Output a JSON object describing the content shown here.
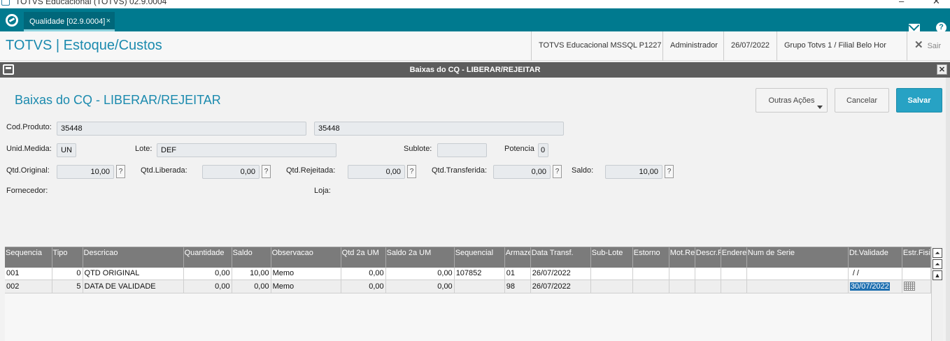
{
  "window": {
    "title": "TOTVS Educacional (TOTVS) 02.9.0004",
    "min": "–",
    "close": "✕"
  },
  "tabbar": {
    "tab_label": "Qualidade [02.9.0004]",
    "tab_close": "×"
  },
  "header": {
    "app_title": "TOTVS | Estoque/Custos",
    "environment": "TOTVS Educacional MSSQL P1227",
    "user": "Administrador",
    "date": "26/07/2022",
    "branch": "Grupo Totvs 1 / Filial Belo Hor",
    "exit_label": "Sair"
  },
  "dialog": {
    "title": "Baixas do CQ - LIBERAR/REJEITAR",
    "form_title": "Baixas do CQ - LIBERAR/REJEITAR",
    "close": "✕"
  },
  "actions": {
    "other": "Outras Ações",
    "cancel": "Cancelar",
    "save": "Salvar"
  },
  "form": {
    "cod_produto_label": "Cod.Produto:",
    "cod_produto": "35448",
    "cod_produto_desc": "35448",
    "unid_medida_label": "Unid.Medida:",
    "unid_medida": "UN",
    "lote_label": "Lote:",
    "lote": "DEF",
    "sublote_label": "Sublote:",
    "sublote": "",
    "potencia_label": "Potencia",
    "potencia": "0",
    "qtd_original_label": "Qtd.Original:",
    "qtd_original": "10,00",
    "qtd_liberada_label": "Qtd.Liberada:",
    "qtd_liberada": "0,00",
    "qtd_rejeitada_label": "Qtd.Rejeitada:",
    "qtd_rejeitada": "0,00",
    "qtd_transferida_label": "Qtd.Transferida:",
    "qtd_transferida": "0,00",
    "saldo_label": "Saldo:",
    "saldo": "10,00",
    "fornecedor_label": "Fornecedor:",
    "loja_label": "Loja:",
    "help_glyph": "?"
  },
  "grid": {
    "columns": [
      "Sequencia",
      "Tipo",
      "Descricao",
      "Quantidade",
      "Saldo",
      "Observacao",
      "Qtd 2a UM",
      "Saldo 2a UM",
      "Sequencial",
      "Armazem",
      "Data Transf.",
      "Sub-Lote",
      "Estorno",
      "Mot.Rej",
      "Descr.Rej",
      "Endereco",
      "Num de Serie",
      "Dt.Validade",
      "Estr.Fisica"
    ],
    "rows": [
      {
        "seq": "001",
        "tipo": "0",
        "desc": "QTD ORIGINAL",
        "qtd": "0,00",
        "saldo": "10,00",
        "obs": "Memo",
        "qtd2": "0,00",
        "saldo2": "0,00",
        "sequencial": "107852",
        "armazem": "01",
        "data": "26/07/2022",
        "validade": " /  /"
      },
      {
        "seq": "002",
        "tipo": "5",
        "desc": "DATA DE VALIDADE",
        "qtd": "0,00",
        "saldo": "0,00",
        "obs": "Memo",
        "qtd2": "0,00",
        "saldo2": "0,00",
        "sequencial": "",
        "armazem": "98",
        "data": "26/07/2022",
        "validade": "30/07/2022"
      }
    ]
  },
  "scroll": {
    "top": "⏶",
    "up": "▲"
  }
}
